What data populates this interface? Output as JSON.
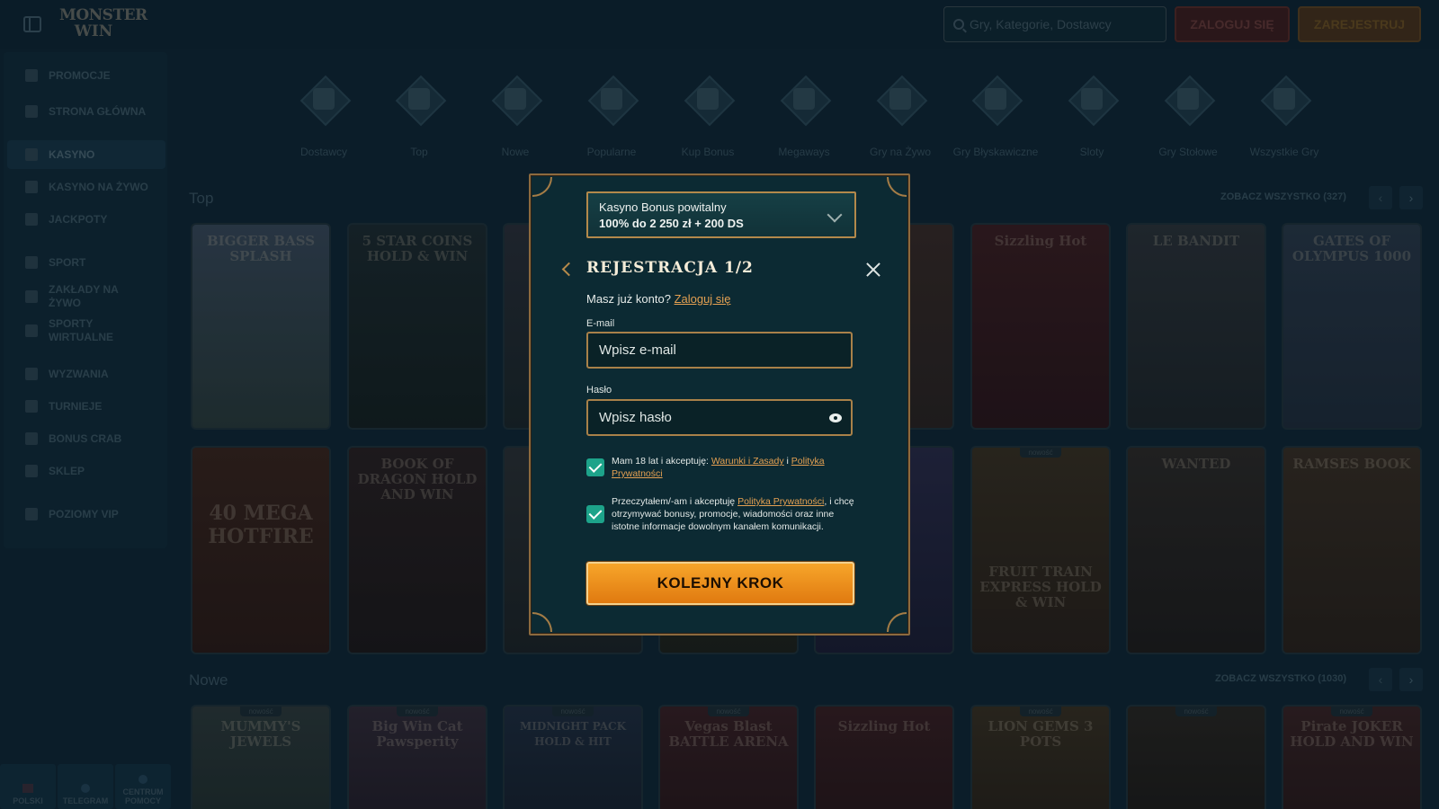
{
  "header": {
    "logo_line1": "MONSTER",
    "logo_line2": "WIN",
    "search_placeholder": "Gry, Kategorie, Dostawcy",
    "login_label": "ZALOGUJ SIĘ",
    "register_label": "ZAREJESTRUJ"
  },
  "sidebar": {
    "items": [
      {
        "label": "PROMOCJE",
        "icon": "gift-icon"
      },
      {
        "label": "STRONA GŁÓWNA",
        "icon": "home-icon"
      },
      {
        "label": "KASYNO",
        "icon": "slot-icon",
        "active": true
      },
      {
        "label": "KASYNO NA ŻYWO",
        "icon": "cards-icon"
      },
      {
        "label": "JACKPOTY",
        "icon": "jackpot-icon"
      },
      {
        "label": "SPORT",
        "icon": "ball-icon"
      },
      {
        "label": "ZAKŁADY NA ŻYWO",
        "icon": "live-icon"
      },
      {
        "label": "SPORTY WIRTUALNE",
        "icon": "virtual-icon"
      },
      {
        "label": "WYZWANIA",
        "icon": "challenge-icon"
      },
      {
        "label": "TURNIEJE",
        "icon": "trophy-icon"
      },
      {
        "label": "BONUS CRAB",
        "icon": "crab-icon"
      },
      {
        "label": "SKLEP",
        "icon": "shop-icon"
      },
      {
        "label": "POZIOMY VIP",
        "icon": "diamond-icon"
      }
    ],
    "footer": [
      {
        "label": "POLSKI",
        "icon": "flag-icon"
      },
      {
        "label": "TELEGRAM",
        "icon": "telegram-icon"
      },
      {
        "label": "CENTRUM POMOCY",
        "icon": "help-icon"
      }
    ]
  },
  "categories": [
    "Dostawcy",
    "Top",
    "Nowe",
    "Popularne",
    "Kup Bonus",
    "Megaways",
    "Gry na Żywo",
    "Gry Błyskawiczne",
    "Sloty",
    "Gry Stołowe",
    "Wszystkie Gry"
  ],
  "sections": {
    "top": {
      "title": "Top",
      "see_all": "ZOBACZ WSZYSTKO (327)"
    },
    "new": {
      "title": "Nowe",
      "see_all": "ZOBACZ WSZYSTKO (1030)"
    }
  },
  "games_row1": [
    "BIGGER BASS SPLASH",
    "5 STAR COINS HOLD & WIN",
    "",
    "",
    "",
    "Sizzling Hot",
    "LE BANDIT",
    "GATES OF OLYMPUS 1000"
  ],
  "games_row2": [
    "40 MEGA HOTFIRE",
    "BOOK OF DRAGON HOLD AND WIN",
    "",
    "",
    "",
    "FRUIT TRAIN EXPRESS HOLD & WIN",
    "WANTED",
    "RAMSES BOOK"
  ],
  "games_row3": [
    "MUMMY'S JEWELS",
    "Big Win Cat Pawsperity",
    "MIDNIGHT PACK HOLD & HIT",
    "Vegas Blast BATTLE ARENA",
    "Sizzling Hot",
    "LION GEMS 3 POTS",
    "",
    "Pirate JOKER HOLD AND WIN"
  ],
  "new_badge": "nowość",
  "modal": {
    "bonus_line1": "Kasyno Bonus powitalny",
    "bonus_line2": "100% do 2 250 zł + 200 DS",
    "title": "REJESTRACJA 1/2",
    "have_account": "Masz już konto?",
    "login_link": "Zaloguj się",
    "email_label": "E-mail",
    "email_placeholder": "Wpisz e-mail",
    "password_label": "Hasło",
    "password_placeholder": "Wpisz hasło",
    "terms_prefix": "Mam 18 lat i akceptuję:",
    "terms_link": "Warunki i Zasady",
    "terms_and": "i",
    "privacy_link": "Polityka Prywatności",
    "consent_prefix": "Przeczytałem/-am i akceptuję",
    "consent_link": "Polityka Prywatności",
    "consent_suffix": ", i chcę otrzymywać bonusy, promocje, wiadomości oraz inne istotne informacje dowolnym kanałem komunikacji.",
    "next_label": "KOLEJNY KROK"
  }
}
